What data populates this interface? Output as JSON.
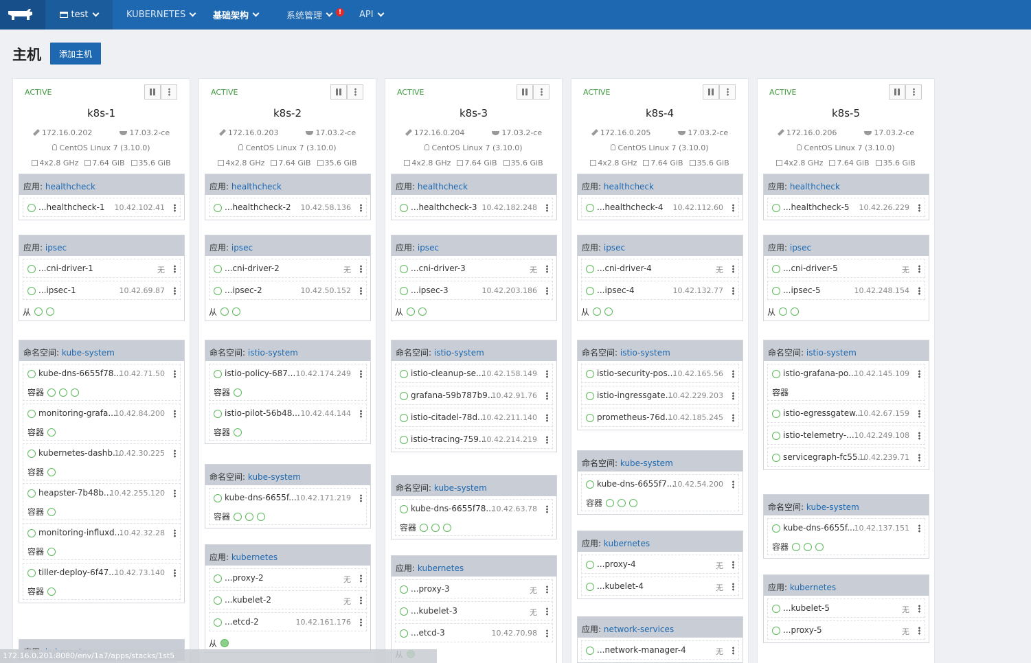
{
  "nav": {
    "env": "test",
    "items": [
      "KUBERNETES",
      "基础架构",
      "系统管理",
      "API"
    ],
    "alert": "!"
  },
  "page": {
    "title": "主机",
    "add_button": "添加主机"
  },
  "labels": {
    "app": "应用: ",
    "ns": "命名空间: ",
    "container": "容器",
    "sidekick": "从",
    "none": "无"
  },
  "status_url": "172.16.0.201:8080/env/1a7/apps/stacks/1st5",
  "hosts": [
    {
      "state": "ACTIVE",
      "name": "k8s-1",
      "ip": "172.16.0.202",
      "docker": "17.03.2-ce",
      "os": "CentOS Linux 7 (3.10.0)",
      "cpu": "4x2.8 GHz",
      "ram": "7.64 GiB",
      "disk": "35.6 GiB",
      "hc": {
        "app": "healthcheck",
        "name": "...healthcheck-1",
        "ip": "10.42.102.41"
      },
      "ipsec": {
        "app": "ipsec",
        "cni": "...cni-driver-1",
        "ipsec": "...ipsec-1",
        "ipsec_ip": "10.42.69.87"
      },
      "ns": "kube-system",
      "containers": [
        {
          "n": "kube-dns-6655f78...",
          "ip": "10.42.71.50"
        },
        {
          "n": "monitoring-grafa...",
          "ip": "10.42.84.200"
        },
        {
          "n": "kubernetes-dashb...",
          "ip": "10.42.30.225"
        },
        {
          "n": "heapster-7b48b...",
          "ip": "10.42.255.120"
        },
        {
          "n": "monitoring-influxd...",
          "ip": "10.42.32.28"
        },
        {
          "n": "tiller-deploy-6f47...",
          "ip": "10.42.73.140"
        }
      ],
      "app3": "kubernetes"
    },
    {
      "state": "ACTIVE",
      "name": "k8s-2",
      "ip": "172.16.0.203",
      "docker": "17.03.2-ce",
      "os": "CentOS Linux 7 (3.10.0)",
      "cpu": "4x2.8 GHz",
      "ram": "7.64 GiB",
      "disk": "35.6 GiB",
      "hc": {
        "app": "healthcheck",
        "name": "...healthcheck-2",
        "ip": "10.42.58.136"
      },
      "ipsec": {
        "app": "ipsec",
        "cni": "...cni-driver-2",
        "ipsec": "...ipsec-2",
        "ipsec_ip": "10.42.50.152"
      },
      "ns": "istio-system",
      "containers": [
        {
          "n": "istio-policy-687...",
          "ip": "10.42.174.249"
        },
        {
          "n": "istio-pilot-56b48...",
          "ip": "10.42.44.144"
        }
      ],
      "ns2": "kube-system",
      "ns2c": {
        "n": "kube-dns-6655f...",
        "ip": "10.42.171.219"
      },
      "app3": "kubernetes",
      "k8s": [
        {
          "n": "...proxy-2"
        },
        {
          "n": "...kubelet-2"
        },
        {
          "n": "...etcd-2",
          "ip": "10.42.161.176"
        }
      ]
    },
    {
      "state": "ACTIVE",
      "name": "k8s-3",
      "ip": "172.16.0.204",
      "docker": "17.03.2-ce",
      "os": "CentOS Linux 7 (3.10.0)",
      "cpu": "4x2.8 GHz",
      "ram": "7.64 GiB",
      "disk": "35.6 GiB",
      "hc": {
        "app": "healthcheck",
        "name": "...healthcheck-3",
        "ip": "10.42.182.248"
      },
      "ipsec": {
        "app": "ipsec",
        "cni": "...cni-driver-3",
        "ipsec": "...ipsec-3",
        "ipsec_ip": "10.42.203.186"
      },
      "ns": "istio-system",
      "containers": [
        {
          "n": "istio-cleanup-se...",
          "ip": "10.42.158.149"
        },
        {
          "n": "grafana-59b787b9...",
          "ip": "10.42.91.76"
        },
        {
          "n": "istio-citadel-78d...",
          "ip": "10.42.211.140"
        },
        {
          "n": "istio-tracing-759...",
          "ip": "10.42.214.219"
        }
      ],
      "ns2": "kube-system",
      "ns2c": {
        "n": "kube-dns-6655f78...",
        "ip": "10.42.63.78"
      },
      "app3": "kubernetes",
      "k8s": [
        {
          "n": "...proxy-3"
        },
        {
          "n": "...kubelet-3"
        },
        {
          "n": "...etcd-3",
          "ip": "10.42.70.98"
        }
      ]
    },
    {
      "state": "ACTIVE",
      "name": "k8s-4",
      "ip": "172.16.0.205",
      "docker": "17.03.2-ce",
      "os": "CentOS Linux 7 (3.10.0)",
      "cpu": "4x2.8 GHz",
      "ram": "7.64 GiB",
      "disk": "35.6 GiB",
      "hc": {
        "app": "healthcheck",
        "name": "...healthcheck-4",
        "ip": "10.42.112.60"
      },
      "ipsec": {
        "app": "ipsec",
        "cni": "...cni-driver-4",
        "ipsec": "...ipsec-4",
        "ipsec_ip": "10.42.132.77"
      },
      "ns": "istio-system",
      "containers": [
        {
          "n": "istio-security-pos...",
          "ip": "10.42.165.56"
        },
        {
          "n": "istio-ingressgate...",
          "ip": "10.42.229.203"
        },
        {
          "n": "prometheus-76d...",
          "ip": "10.42.185.245"
        }
      ],
      "ns2": "kube-system",
      "ns2c": {
        "n": "kube-dns-6655f7...",
        "ip": "10.42.54.200"
      },
      "app3": "kubernetes",
      "k8s": [
        {
          "n": "...proxy-4"
        },
        {
          "n": "...kubelet-4"
        }
      ],
      "app4": "network-services",
      "net": "...network-manager-4"
    },
    {
      "state": "ACTIVE",
      "name": "k8s-5",
      "ip": "172.16.0.206",
      "docker": "17.03.2-ce",
      "os": "CentOS Linux 7 (3.10.0)",
      "cpu": "4x2.8 GHz",
      "ram": "7.64 GiB",
      "disk": "35.6 GiB",
      "hc": {
        "app": "healthcheck",
        "name": "...healthcheck-5",
        "ip": "10.42.26.229"
      },
      "ipsec": {
        "app": "ipsec",
        "cni": "...cni-driver-5",
        "ipsec": "...ipsec-5",
        "ipsec_ip": "10.42.248.154"
      },
      "ns": "istio-system",
      "containers": [
        {
          "n": "istio-grafana-po...",
          "ip": "10.42.145.109"
        },
        {
          "n": "istio-egressgatew...",
          "ip": "10.42.67.159"
        },
        {
          "n": "istio-telemetry-...",
          "ip": "10.42.249.108"
        },
        {
          "n": "servicegraph-fc55...",
          "ip": "10.42.239.71"
        }
      ],
      "ns2": "kube-system",
      "ns2c": {
        "n": "kube-dns-6655f...",
        "ip": "10.42.137.151"
      },
      "app3": "kubernetes",
      "k8s": [
        {
          "n": "...kubelet-5"
        },
        {
          "n": "...proxy-5"
        }
      ]
    }
  ]
}
